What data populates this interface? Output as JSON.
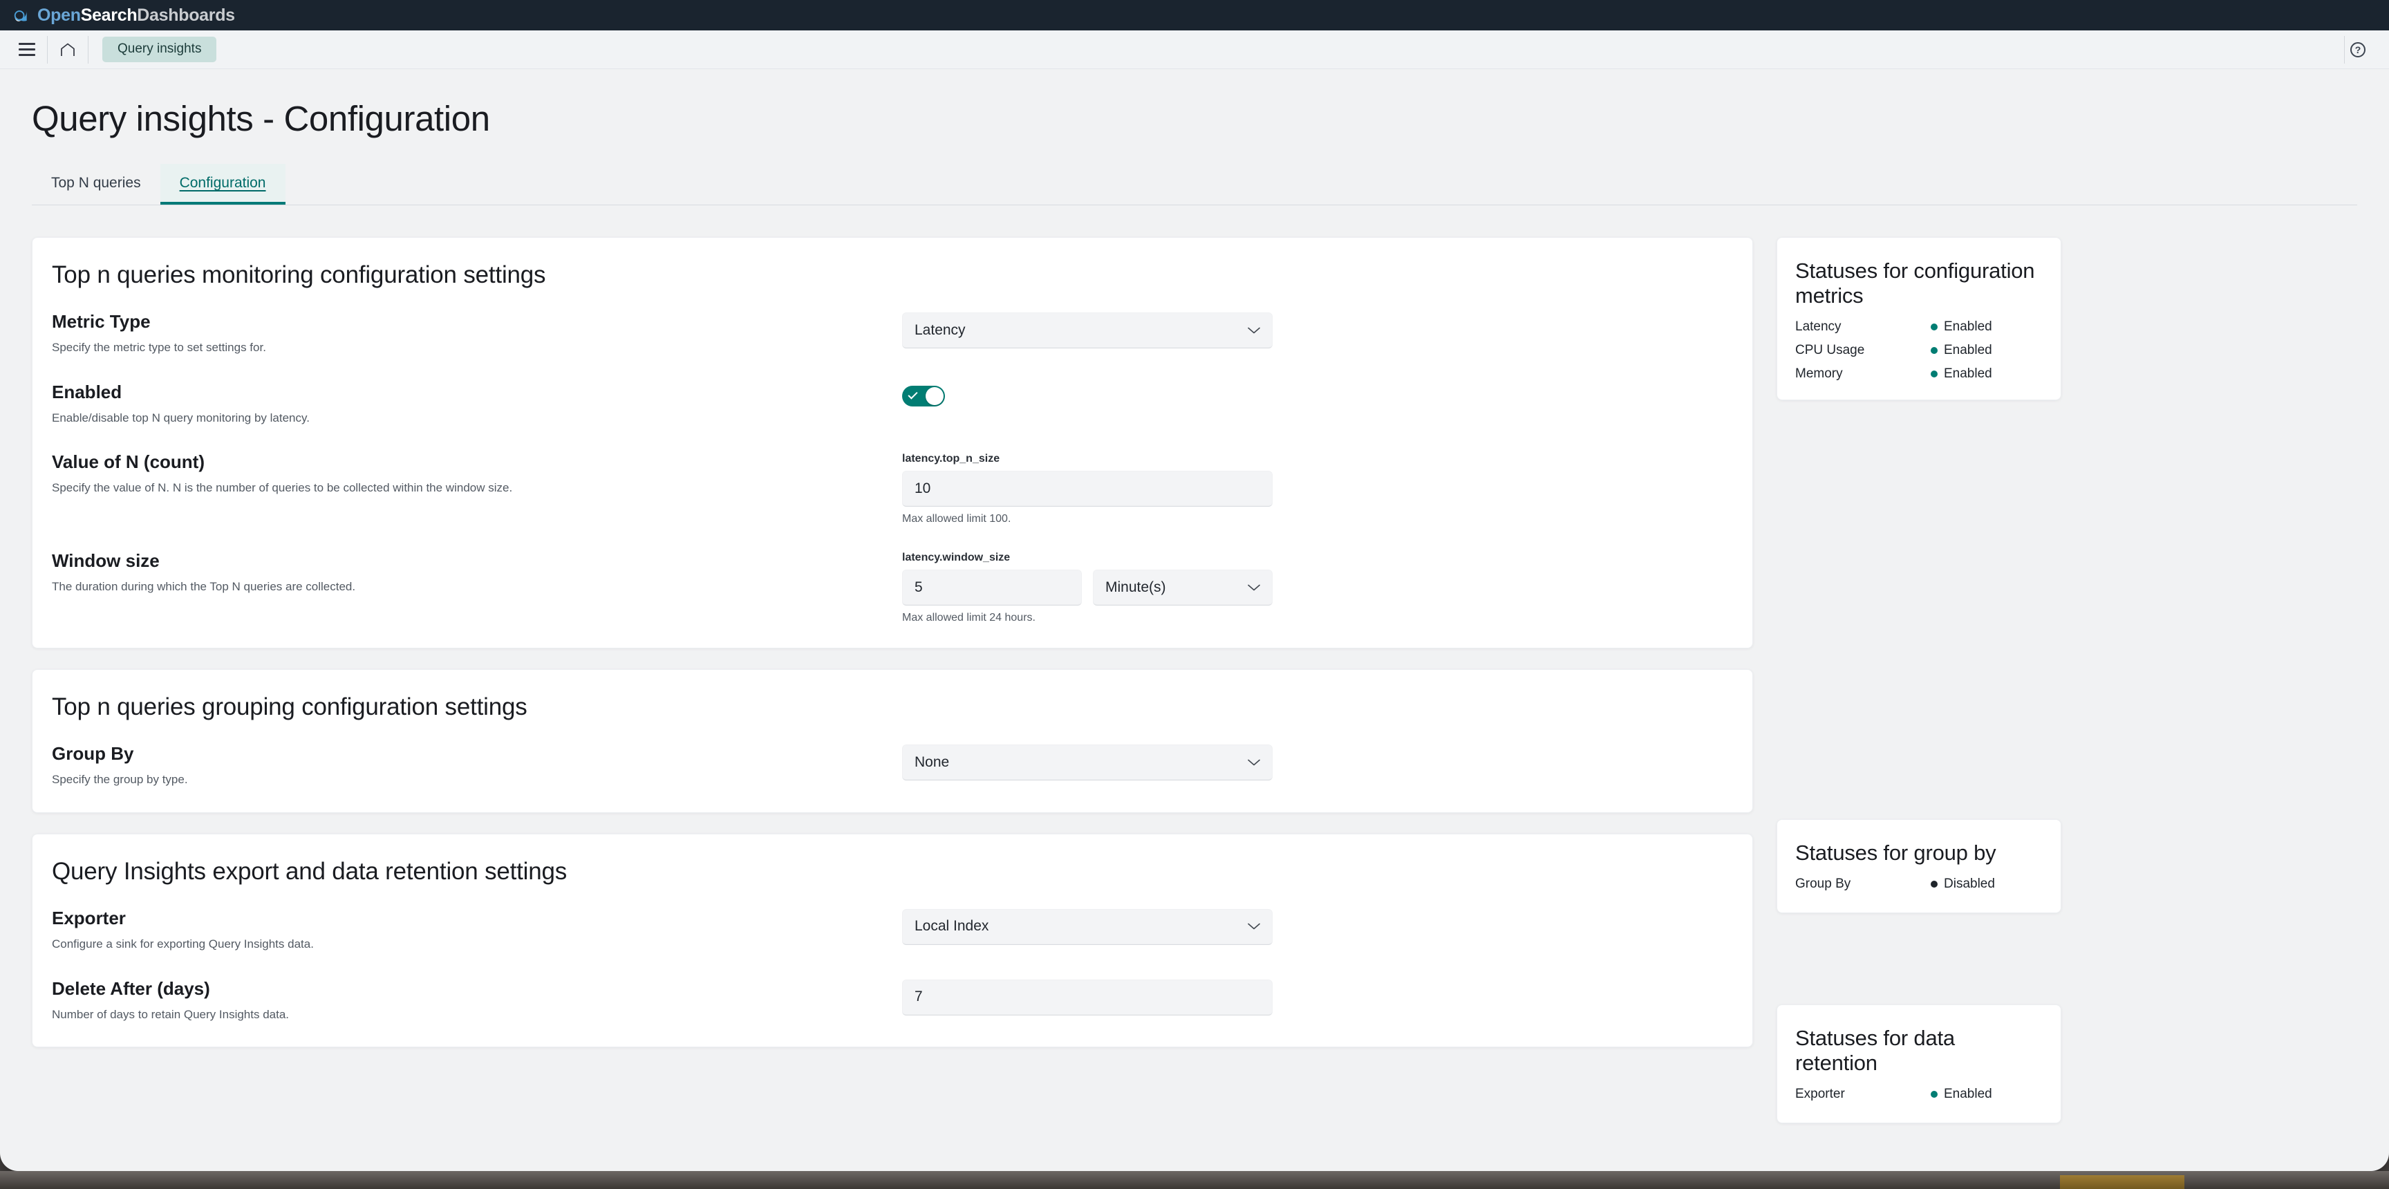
{
  "topbar": {
    "brand_part1": "Open",
    "brand_part2": "Search",
    "brand_part3": "Dashboards",
    "logo_icon": "opensearch-logo-icon"
  },
  "navbar": {
    "menu_icon": "hamburger-menu-icon",
    "home_icon": "home-icon",
    "breadcrumb": "Query insights",
    "help_icon": "help-question-icon",
    "help_glyph": "?"
  },
  "page": {
    "title": "Query insights - Configuration"
  },
  "tabs": [
    {
      "label": "Top N queries",
      "active": false
    },
    {
      "label": "Configuration",
      "active": true
    }
  ],
  "panels": {
    "monitoring": {
      "title": "Top n queries monitoring configuration settings",
      "metric_type": {
        "label": "Metric Type",
        "description": "Specify the metric type to set settings for.",
        "value": "Latency"
      },
      "enabled": {
        "label": "Enabled",
        "description": "Enable/disable top N query monitoring by latency.",
        "value": "on"
      },
      "value_of_n": {
        "label": "Value of N (count)",
        "description": "Specify the value of N. N is the number of queries to be collected within the window size.",
        "field_label": "latency.top_n_size",
        "value": "10",
        "hint": "Max allowed limit 100."
      },
      "window_size": {
        "label": "Window size",
        "description": "The duration during which the Top N queries are collected.",
        "field_label": "latency.window_size",
        "value": "5",
        "unit": "Minute(s)",
        "hint": "Max allowed limit 24 hours."
      }
    },
    "grouping": {
      "title": "Top n queries grouping configuration settings",
      "group_by": {
        "label": "Group By",
        "description": "Specify the group by type.",
        "value": "None"
      }
    },
    "export": {
      "title": "Query Insights export and data retention settings",
      "exporter": {
        "label": "Exporter",
        "description": "Configure a sink for exporting Query Insights data.",
        "value": "Local Index"
      },
      "delete_after": {
        "label": "Delete After (days)",
        "description": "Number of days to retain Query Insights data.",
        "value": "7"
      }
    }
  },
  "statuses": {
    "config_metrics": {
      "title": "Statuses for configuration metrics",
      "rows": [
        {
          "name": "Latency",
          "value": "Enabled",
          "color": "#017d73"
        },
        {
          "name": "CPU Usage",
          "value": "Enabled",
          "color": "#017d73"
        },
        {
          "name": "Memory",
          "value": "Enabled",
          "color": "#017d73"
        }
      ]
    },
    "group_by": {
      "title": "Statuses for group by",
      "rows": [
        {
          "name": "Group By",
          "value": "Disabled",
          "color": "#1f242b"
        }
      ]
    },
    "data_retention": {
      "title": "Statuses for data retention",
      "rows": [
        {
          "name": "Exporter",
          "value": "Enabled",
          "color": "#017d73"
        }
      ]
    }
  },
  "colors": {
    "brand_dark": "#1a242f",
    "accent_teal": "#017d73",
    "tab_active": "#006b68",
    "breadcrumb_chip": "#c9dfdc"
  }
}
